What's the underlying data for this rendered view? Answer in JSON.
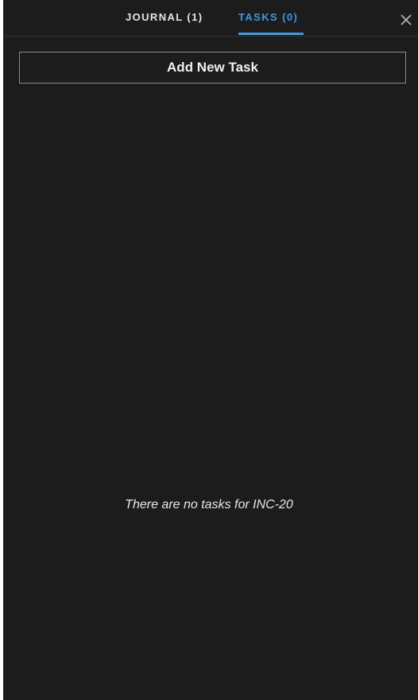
{
  "tabs": [
    {
      "label": "JOURNAL (1)",
      "active": false
    },
    {
      "label": "TASKS (0)",
      "active": true
    }
  ],
  "close_icon": "close-icon",
  "add_task": {
    "label": "Add New Task"
  },
  "empty_state": {
    "message": "There are no tasks for INC-20"
  },
  "colors": {
    "background": "#1c1c1c",
    "accent": "#3b99e0",
    "text": "#e6e6e6",
    "border": "#8a8a8a"
  }
}
